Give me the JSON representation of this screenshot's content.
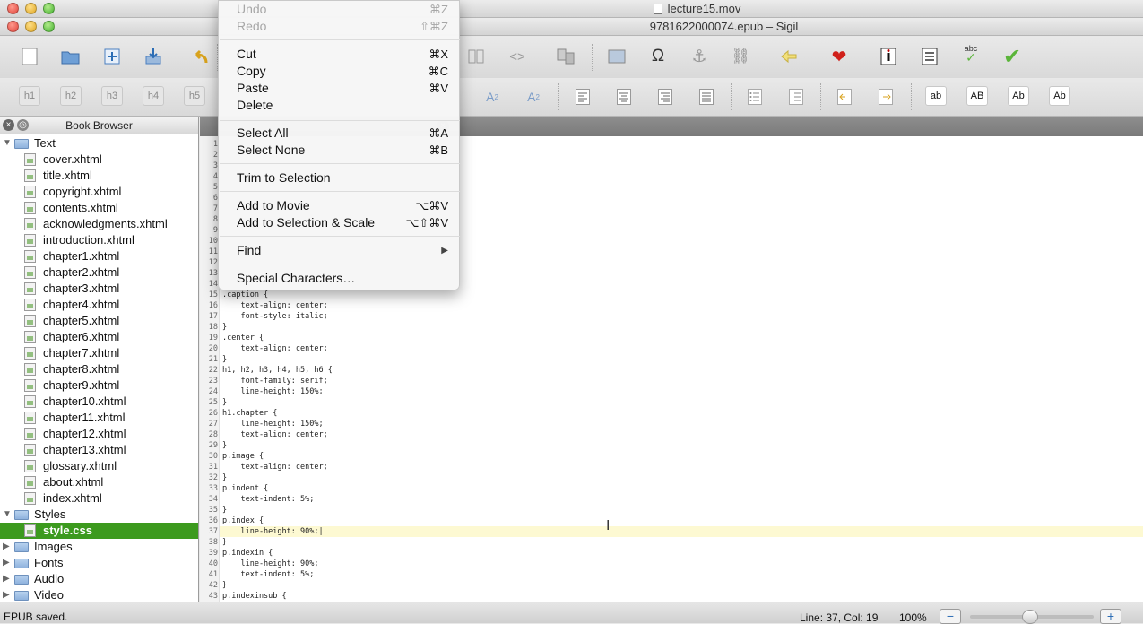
{
  "background_window": {
    "title": "lecture15.mov"
  },
  "window": {
    "title": "9781622000074.epub – Sigil"
  },
  "toolbar_icons": [
    "new-file-icon",
    "open-icon",
    "add-icon",
    "save-icon",
    "undo-icon",
    "book-view-icon",
    "code-view-icon",
    "split-view-icon",
    "image-icon",
    "omega-icon",
    "anchor-icon",
    "link-icon",
    "back-arrow-icon",
    "heart-icon",
    "metadata-icon",
    "toc-icon",
    "spellcheck-icon",
    "validate-check-icon"
  ],
  "format_toolbar": {
    "headings": [
      "h1",
      "h2",
      "h3",
      "h4",
      "h5"
    ],
    "case_buttons": [
      "ab",
      "AB",
      "Ab",
      "Ab"
    ]
  },
  "book_browser": {
    "title": "Book Browser",
    "tree": [
      {
        "label": "Text",
        "type": "folder",
        "open": true
      },
      {
        "label": "cover.xhtml",
        "type": "file"
      },
      {
        "label": "title.xhtml",
        "type": "file"
      },
      {
        "label": "copyright.xhtml",
        "type": "file"
      },
      {
        "label": "contents.xhtml",
        "type": "file"
      },
      {
        "label": "acknowledgments.xhtml",
        "type": "file"
      },
      {
        "label": "introduction.xhtml",
        "type": "file"
      },
      {
        "label": "chapter1.xhtml",
        "type": "file"
      },
      {
        "label": "chapter2.xhtml",
        "type": "file"
      },
      {
        "label": "chapter3.xhtml",
        "type": "file"
      },
      {
        "label": "chapter4.xhtml",
        "type": "file"
      },
      {
        "label": "chapter5.xhtml",
        "type": "file"
      },
      {
        "label": "chapter6.xhtml",
        "type": "file"
      },
      {
        "label": "chapter7.xhtml",
        "type": "file"
      },
      {
        "label": "chapter8.xhtml",
        "type": "file"
      },
      {
        "label": "chapter9.xhtml",
        "type": "file"
      },
      {
        "label": "chapter10.xhtml",
        "type": "file"
      },
      {
        "label": "chapter11.xhtml",
        "type": "file"
      },
      {
        "label": "chapter12.xhtml",
        "type": "file"
      },
      {
        "label": "chapter13.xhtml",
        "type": "file"
      },
      {
        "label": "glossary.xhtml",
        "type": "file"
      },
      {
        "label": "about.xhtml",
        "type": "file"
      },
      {
        "label": "index.xhtml",
        "type": "file"
      },
      {
        "label": "Styles",
        "type": "folder",
        "open": true
      },
      {
        "label": "style.css",
        "type": "file",
        "selected": true
      },
      {
        "label": "Images",
        "type": "folder",
        "open": false
      },
      {
        "label": "Fonts",
        "type": "folder",
        "open": false
      },
      {
        "label": "Audio",
        "type": "folder",
        "open": false
      },
      {
        "label": "Video",
        "type": "folder",
        "open": false
      }
    ]
  },
  "editor": {
    "line_numbers": [
      "1",
      "2",
      "3",
      "4",
      "5",
      "6",
      "7",
      "8",
      "9",
      "10",
      "11",
      "12",
      "13",
      "14",
      "15",
      "16",
      "17",
      "18",
      "19",
      "20",
      "21",
      "22",
      "23",
      "24",
      "25",
      "26",
      "27",
      "28",
      "29",
      "30",
      "31",
      "32",
      "33",
      "34",
      "35",
      "36",
      "37",
      "38",
      "39",
      "40",
      "41",
      "42",
      "43"
    ],
    "visible_code": [
      {
        "n": 15,
        "text": ".caption {"
      },
      {
        "n": 16,
        "text": "    text-align: center;"
      },
      {
        "n": 17,
        "text": "    font-style: italic;"
      },
      {
        "n": 18,
        "text": "}"
      },
      {
        "n": 19,
        "text": ".center {"
      },
      {
        "n": 20,
        "text": "    text-align: center;"
      },
      {
        "n": 21,
        "text": "}"
      },
      {
        "n": 22,
        "text": "h1, h2, h3, h4, h5, h6 {"
      },
      {
        "n": 23,
        "text": "    font-family: serif;"
      },
      {
        "n": 24,
        "text": "    line-height: 150%;"
      },
      {
        "n": 25,
        "text": "}"
      },
      {
        "n": 26,
        "text": "h1.chapter {"
      },
      {
        "n": 27,
        "text": "    line-height: 150%;"
      },
      {
        "n": 28,
        "text": "    text-align: center;"
      },
      {
        "n": 29,
        "text": "}"
      },
      {
        "n": 30,
        "text": "p.image {"
      },
      {
        "n": 31,
        "text": "    text-align: center;"
      },
      {
        "n": 32,
        "text": "}"
      },
      {
        "n": 33,
        "text": "p.indent {"
      },
      {
        "n": 34,
        "text": "    text-indent: 5%;"
      },
      {
        "n": 35,
        "text": "}"
      },
      {
        "n": 36,
        "text": "p.index {"
      },
      {
        "n": 37,
        "text": "    line-height: 90%;|"
      },
      {
        "n": 38,
        "text": "}"
      },
      {
        "n": 39,
        "text": "p.indexin {"
      },
      {
        "n": 40,
        "text": "    line-height: 90%;"
      },
      {
        "n": 41,
        "text": "    text-indent: 5%;"
      },
      {
        "n": 42,
        "text": "}"
      },
      {
        "n": 43,
        "text": "p.indexinsub {"
      }
    ],
    "current_line": 37
  },
  "status": {
    "message": "EPUB saved.",
    "position": "Line: 37, Col: 19",
    "zoom": "100%"
  },
  "edit_menu": {
    "items": [
      {
        "label": "Undo",
        "shortcut": "⌘Z",
        "disabled": true
      },
      {
        "label": "Redo",
        "shortcut": "⇧⌘Z",
        "disabled": true
      },
      {
        "sep": true
      },
      {
        "label": "Cut",
        "shortcut": "⌘X"
      },
      {
        "label": "Copy",
        "shortcut": "⌘C"
      },
      {
        "label": "Paste",
        "shortcut": "⌘V"
      },
      {
        "label": "Delete",
        "shortcut": ""
      },
      {
        "sep": true
      },
      {
        "label": "Select All",
        "shortcut": "⌘A"
      },
      {
        "label": "Select None",
        "shortcut": "⌘B"
      },
      {
        "sep": true
      },
      {
        "label": "Trim to Selection",
        "shortcut": ""
      },
      {
        "sep": true
      },
      {
        "label": "Add to Movie",
        "shortcut": "⌥⌘V"
      },
      {
        "label": "Add to Selection & Scale",
        "shortcut": "⌥⇧⌘V"
      },
      {
        "sep": true
      },
      {
        "label": "Find",
        "shortcut": "▶"
      },
      {
        "sep": true
      },
      {
        "label": "Special Characters…",
        "shortcut": ""
      }
    ]
  },
  "colors": {
    "selection": "#3c9a1e",
    "current_line": "#fdf9d2"
  }
}
